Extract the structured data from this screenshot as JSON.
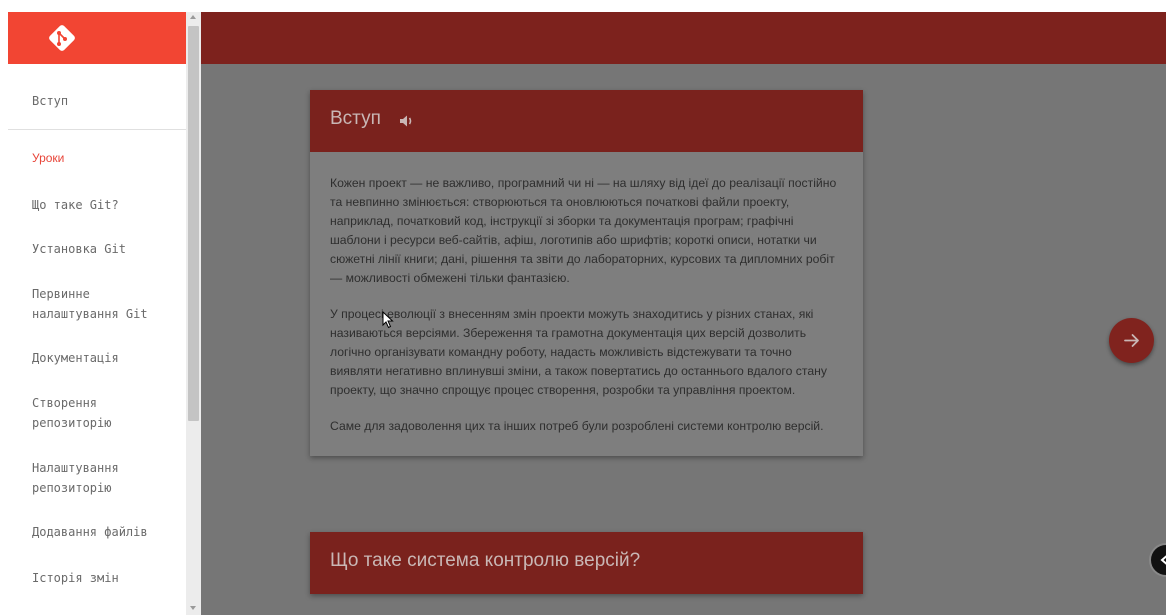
{
  "sidebar": {
    "logo_alt": "git-logo",
    "top_item": "Вступ",
    "section_label": "Уроки",
    "items": [
      "Що таке Git?",
      "Установка Git",
      "Первинне налаштування Git",
      "Документація",
      "Створення репозиторію",
      "Налаштування репозиторію",
      "Додавання файлів",
      "Історія змін"
    ]
  },
  "main": {
    "cards": [
      {
        "title": "Вступ",
        "paragraphs": [
          "Кожен проект — не важливо, програмний чи ні — на шляху від ідеї до реалізації постійно та невпинно змінюється: створюються та оновлюються початкові файли проекту, наприклад, початковий код, інструкції зі зборки та документація програм; графічні шаблони і ресурси веб-сайтів, афіш, логотипів або шрифтів; короткі описи, нотатки чи сюжетні лінії книги; дані, рішення та звіти до лабораторних, курсових та дипломних робіт — можливості обмежені тільки фантазією.",
          "У процесі еволюції з внесенням змін проекти можуть знаходитись у різних станах, які називаються версіями. Збереження та грамотна документація цих версій дозволить логічно організувати командну роботу, надасть можливість відстежувати та точно виявляти негативно вплинувші зміни, а також повертатись до останнього вдалого стану проекту, що значно спрощує процес створення, розробки та управління проектом.",
          "Саме для задоволення цих та інших потреб були розроблені системи контролю версій."
        ]
      },
      {
        "title": "Що таке система контролю версій?"
      }
    ]
  },
  "colors": {
    "brand": "#f24533",
    "topbar_dimmed": "#7d221d",
    "overlay": "#767676",
    "active_nav": "#e8463a"
  }
}
